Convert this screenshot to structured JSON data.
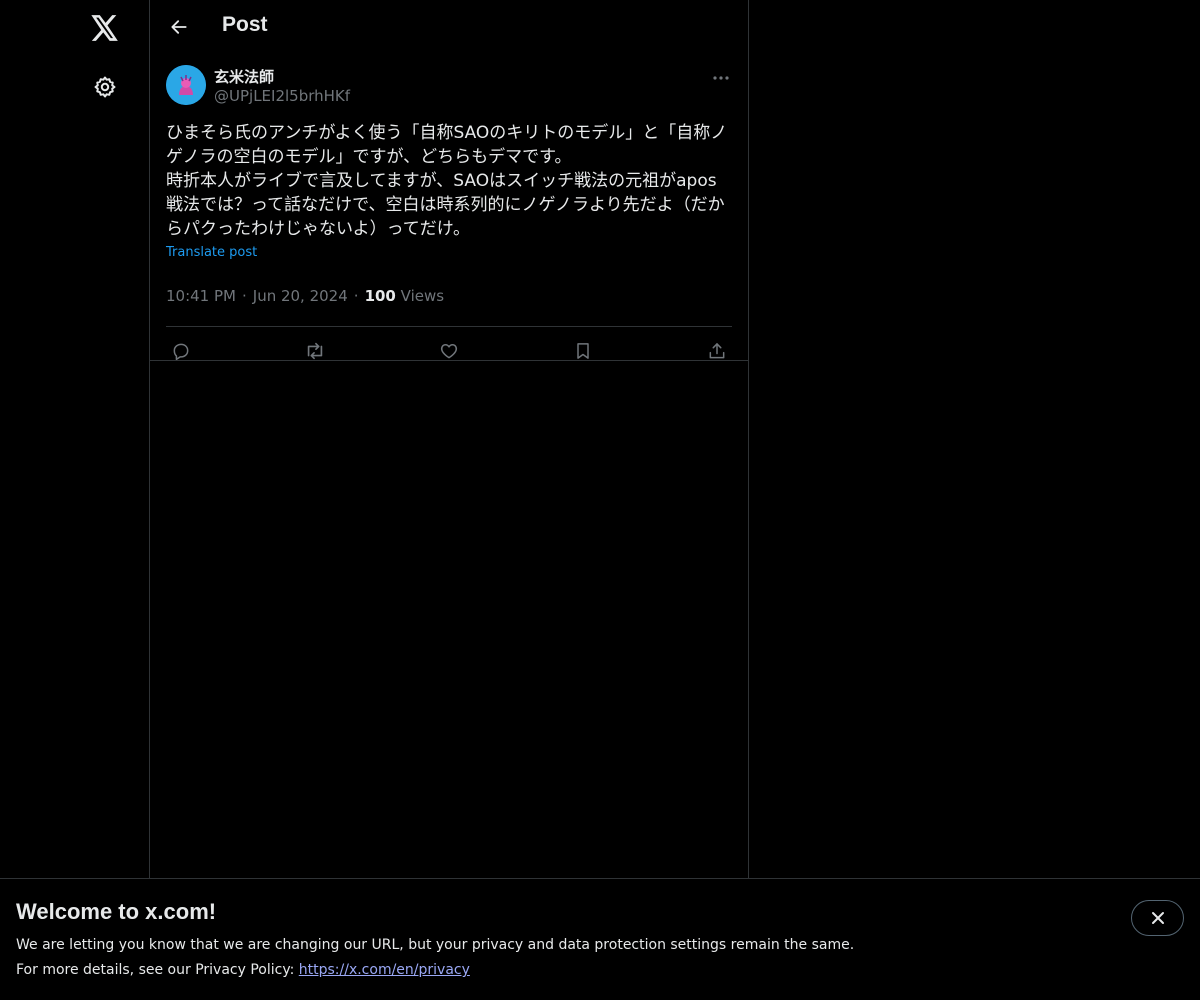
{
  "header": {
    "title": "Post"
  },
  "post": {
    "display_name": "玄米法師",
    "handle": "@UPjLEI2l5brhHKf",
    "text": "ひまそら氏のアンチがよく使う「自称SAOのキリトのモデル」と「自称ノゲノラの空白のモデル」ですが、どちらもデマです。\n時折本人がライブで言及してますが、SAOはスイッチ戦法の元祖がapos戦法では？って話なだけで、空白は時系列的にノゲノラより先だよ（だからパクったわけじゃないよ）ってだけ。",
    "translate_label": "Translate post",
    "time": "10:41 PM",
    "date": "Jun 20, 2024",
    "views_count": "100",
    "views_label": "Views",
    "separator": "·"
  },
  "icons": {
    "logo": "x-logo-icon",
    "settings": "gear-icon",
    "back": "arrow-left-icon",
    "more": "more-horizontal-icon",
    "reply": "reply-icon",
    "repost": "repost-icon",
    "like": "heart-icon",
    "bookmark": "bookmark-icon",
    "share": "share-icon",
    "close": "close-icon"
  },
  "banner": {
    "title": "Welcome to x.com!",
    "line1": "We are letting you know that we are changing our URL, but your privacy and data protection settings remain the same.",
    "line2_prefix": "For more details, see our Privacy Policy: ",
    "privacy_link": "https://x.com/en/privacy"
  },
  "colors": {
    "background": "#000000",
    "text": "#e7e9ea",
    "muted": "#71767b",
    "accent": "#1d9bf0",
    "border": "#2f3336"
  }
}
